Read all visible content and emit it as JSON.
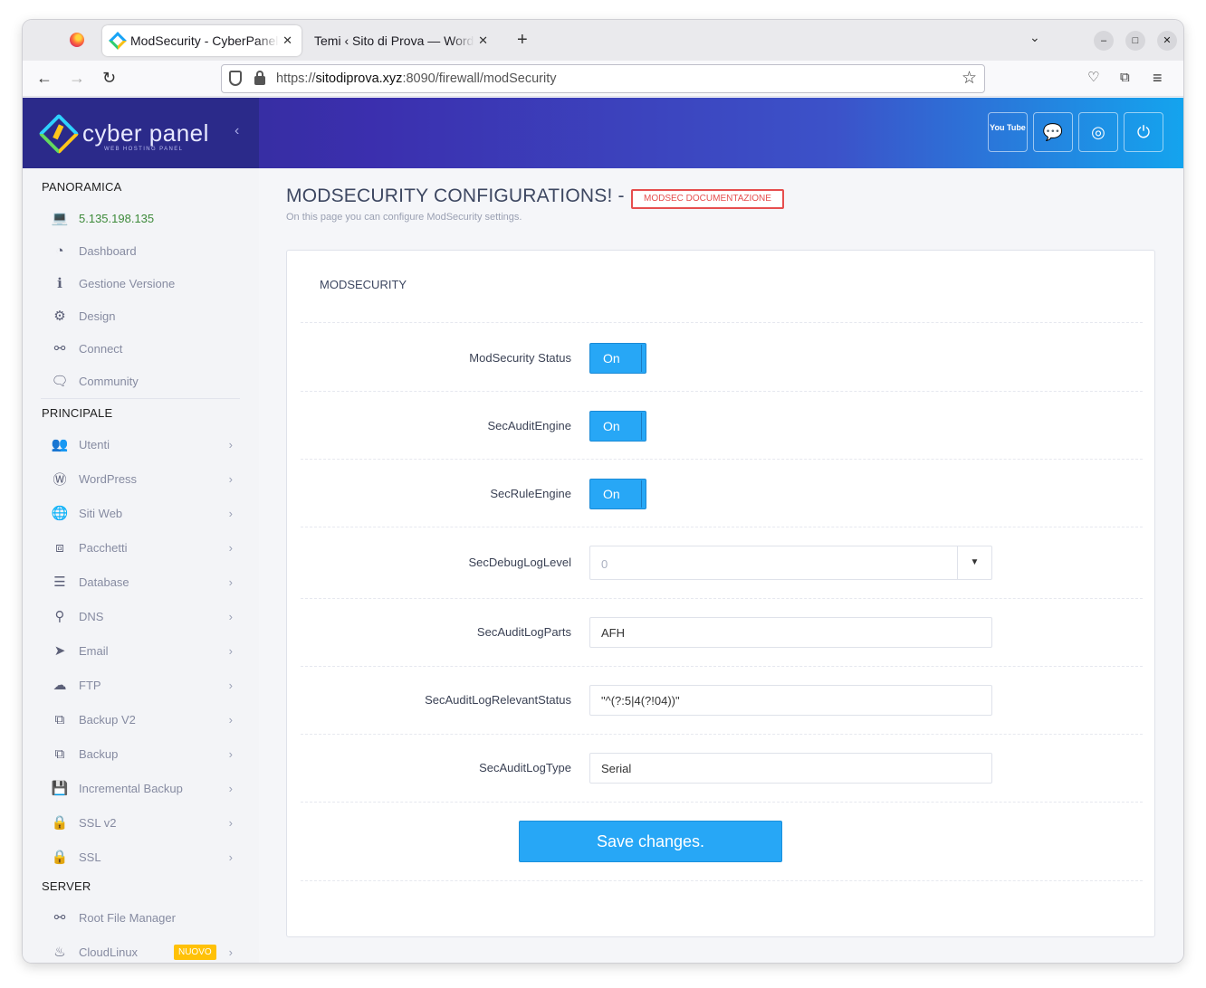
{
  "browser": {
    "tabs": [
      {
        "title": "ModSecurity - CyberPanel",
        "active": true
      },
      {
        "title": "Temi ‹ Sito di Prova — WordPress",
        "active": false
      }
    ],
    "url_prefix": "https://",
    "url_host": "sitodiprova.xyz",
    "url_rest": ":8090/firewall/modSecurity"
  },
  "brand": {
    "name": "cyber panel",
    "tagline": "WEB HOSTING PANEL"
  },
  "header_buttons": [
    {
      "icon": "youtube-icon",
      "label": "You Tube"
    },
    {
      "icon": "chat-icon"
    },
    {
      "icon": "lifebuoy-icon"
    },
    {
      "icon": "power-icon"
    }
  ],
  "sidebar": {
    "sections": {
      "panoramica": "PANORAMICA",
      "principale": "PRINCIPALE",
      "server": "SERVER"
    },
    "panoramica_items": [
      {
        "icon": "laptop-icon",
        "label": "5.135.198.135"
      },
      {
        "icon": "dashboard-icon",
        "label": "Dashboard"
      },
      {
        "icon": "info-icon",
        "label": "Gestione Versione"
      },
      {
        "icon": "gear-icon",
        "label": "Design"
      },
      {
        "icon": "link-icon",
        "label": "Connect"
      },
      {
        "icon": "comments-icon",
        "label": "Community"
      }
    ],
    "principale_items": [
      {
        "icon": "users-icon",
        "label": "Utenti"
      },
      {
        "icon": "wordpress-icon",
        "label": "WordPress"
      },
      {
        "icon": "globe-icon",
        "label": "Siti Web"
      },
      {
        "icon": "cubes-icon",
        "label": "Pacchetti"
      },
      {
        "icon": "database-icon",
        "label": "Database"
      },
      {
        "icon": "sitemap-icon",
        "label": "DNS"
      },
      {
        "icon": "paper-plane-icon",
        "label": "Email"
      },
      {
        "icon": "cloud-upload-icon",
        "label": "FTP"
      },
      {
        "icon": "copy-icon",
        "label": "Backup V2"
      },
      {
        "icon": "copy-icon",
        "label": "Backup"
      },
      {
        "icon": "save-icon",
        "label": "Incremental Backup"
      },
      {
        "icon": "lock-icon",
        "label": "SSL v2"
      },
      {
        "icon": "lock-icon",
        "label": "SSL"
      }
    ],
    "server_items": [
      {
        "icon": "link-icon",
        "label": "Root File Manager"
      },
      {
        "icon": "fire-icon",
        "label": "CloudLinux",
        "badge": "NUOVO"
      }
    ]
  },
  "page": {
    "title": "MODSECURITY CONFIGURATIONS! -",
    "doc_badge": "MODSEC DOCUMENTAZIONE",
    "subtitle": "On this page you can configure ModSecurity settings.",
    "panel_title": "MODSECURITY",
    "toggles": [
      {
        "label": "ModSecurity Status",
        "value": "On"
      },
      {
        "label": "SecAuditEngine",
        "value": "On"
      },
      {
        "label": "SecRuleEngine",
        "value": "On"
      }
    ],
    "debug_level": {
      "label": "SecDebugLogLevel",
      "value": "0"
    },
    "audit_log_parts": {
      "label": "SecAuditLogParts",
      "value": "AFH"
    },
    "relevant_status": {
      "label": "SecAuditLogRelevantStatus",
      "value": "\"^(?:5|4(?!04))\""
    },
    "audit_log_type": {
      "label": "SecAuditLogType",
      "value": "Serial"
    },
    "save_label": "Save changes."
  },
  "colors": {
    "accent": "#27a7f6",
    "danger": "#e64e4e",
    "header_start": "#2e2c8d",
    "header_end": "#14a4ee"
  }
}
